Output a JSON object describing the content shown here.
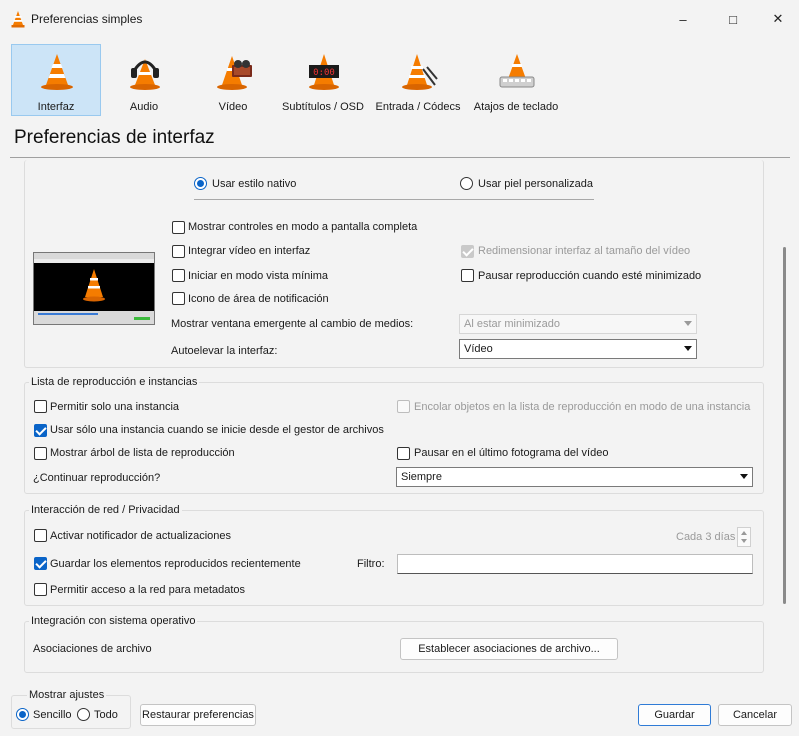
{
  "window": {
    "title": "Preferencias simples",
    "minimize_icon": "minimize-icon",
    "maximize_icon": "maximize-icon",
    "close_icon": "close-icon"
  },
  "categories": [
    {
      "label": "Interfaz",
      "icon": "vlc-cone-icon",
      "active": true
    },
    {
      "label": "Audio",
      "icon": "headphones-cone-icon",
      "active": false
    },
    {
      "label": "Vídeo",
      "icon": "film-cone-icon",
      "active": false
    },
    {
      "label": "Subtítulos / OSD",
      "icon": "subtitles-cone-icon",
      "active": false
    },
    {
      "label": "Entrada / Códecs",
      "icon": "input-cone-icon",
      "active": false
    },
    {
      "label": "Atajos de teclado",
      "icon": "keyboard-cone-icon",
      "active": false
    }
  ],
  "page_title": "Preferencias de interfaz",
  "look": {
    "native_style": {
      "label": "Usar estilo nativo",
      "selected": true
    },
    "custom_skin": {
      "label": "Usar piel personalizada",
      "selected": false
    },
    "options": {
      "fullscreen_controls": {
        "label": "Mostrar controles en modo a pantalla completa",
        "checked": false
      },
      "embed_video": {
        "label": "Integrar vídeo en interfaz",
        "checked": false
      },
      "resize_to_video": {
        "label": "Redimensionar interfaz al tamaño del vídeo",
        "checked": true,
        "disabled": true
      },
      "minimal_view": {
        "label": "Iniciar en modo vista mínima",
        "checked": false
      },
      "pause_minimized": {
        "label": "Pausar reproducción cuando esté minimizado",
        "checked": false
      },
      "systray_icon": {
        "label": "Icono de área de notificación",
        "checked": false
      }
    },
    "popup_label": "Mostrar ventana emergente al cambio de medios:",
    "popup_value": "Al estar minimizado",
    "raise_label": "Autoelevar la interfaz:",
    "raise_value": "Vídeo"
  },
  "playlist": {
    "title": "Lista de reproducción e instancias",
    "one_instance": {
      "label": "Permitir solo una instancia",
      "checked": false
    },
    "enqueue": {
      "label": "Encolar objetos en la lista de reproducción en modo de una instancia",
      "checked": false,
      "disabled": true
    },
    "file_manager": {
      "label": "Usar sólo una instancia cuando se inicie desde el gestor de archivos",
      "checked": true
    },
    "tree": {
      "label": "Mostrar árbol de lista de reproducción",
      "checked": false
    },
    "pause_last": {
      "label": "Pausar en el último fotograma del vídeo",
      "checked": false
    },
    "continue_label": "¿Continuar reproducción?",
    "continue_value": "Siempre"
  },
  "privacy": {
    "title": "Interacción de red / Privacidad",
    "updates": {
      "label": "Activar notificador de actualizaciones",
      "checked": false
    },
    "update_interval": "Cada 3 días",
    "recent": {
      "label": "Guardar los elementos reproducidos recientemente",
      "checked": true
    },
    "filter_label": "Filtro:",
    "filter_value": "",
    "metadata": {
      "label": "Permitir acceso a la red para metadatos",
      "checked": false
    }
  },
  "os": {
    "title": "Integración con sistema operativo",
    "assoc_label": "Asociaciones de archivo",
    "assoc_button": "Establecer asociaciones de archivo..."
  },
  "footer": {
    "show_settings": "Mostrar ajustes",
    "simple": {
      "label": "Sencillo",
      "selected": true
    },
    "all": {
      "label": "Todo",
      "selected": false
    },
    "reset": "Restaurar preferencias",
    "save": "Guardar",
    "cancel": "Cancelar"
  },
  "colors": {
    "accent": "#0a64c8",
    "cone_orange": "#f57c00",
    "active_tab": "#cce4f7"
  }
}
